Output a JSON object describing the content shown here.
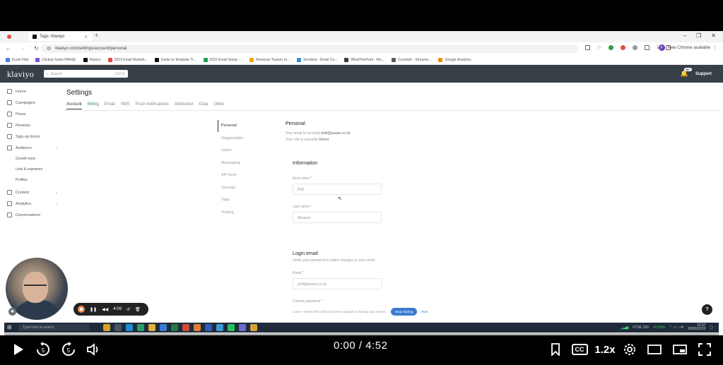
{
  "browser": {
    "tabs": [
      {
        "label": ""
      },
      {
        "label": "Tags: Klaviyo"
      }
    ],
    "url": "klaviyo.com/settings/account/personal",
    "profile_label": "New Chrome available",
    "bookmarks": [
      {
        "label": "Ecom Hub",
        "color": "#4a7de0"
      },
      {
        "label": "Clickup Tasks PAASE",
        "color": "#7b52d9"
      },
      {
        "label": "Klaviyo",
        "color": "#111111"
      },
      {
        "label": "2023 Email Marketi...",
        "color": "#e04b3a"
      },
      {
        "label": "Guide to Template Ti...",
        "color": "#111111"
      },
      {
        "label": "2022 Email Setup -...",
        "color": "#1e9e58"
      },
      {
        "label": "Revenue Tracker m...",
        "color": "#f0a400"
      },
      {
        "label": "Sendinio - Email Co...",
        "color": "#3a8be0"
      },
      {
        "label": "WhatThePoint - Mo...",
        "color": "#3a3a3a"
      },
      {
        "label": "Curentsh - Streame...",
        "color": "#5a5a5a"
      },
      {
        "label": "Google Analytics",
        "color": "#f08c00"
      }
    ]
  },
  "klaviyo": {
    "logo": "klaviyo",
    "search_placeholder": "Search",
    "search_shortcut": "Ctrl+K",
    "notifications_badge": "99+",
    "support_label": "Support",
    "sidebar": {
      "items": [
        {
          "label": "Home",
          "chevron": false
        },
        {
          "label": "Campaigns",
          "chevron": false
        },
        {
          "label": "Flows",
          "chevron": false
        },
        {
          "label": "Reviews",
          "chevron": false
        },
        {
          "label": "Sign-up forms",
          "chevron": false
        },
        {
          "label": "Audience",
          "chevron": true
        }
      ],
      "audience_sub": [
        "Growth tools",
        "Lists & segments",
        "Profiles"
      ],
      "items_bottom": [
        {
          "label": "Content",
          "chevron": true
        },
        {
          "label": "Analytics",
          "chevron": true
        },
        {
          "label": "Conversations",
          "chevron": false
        }
      ]
    },
    "settings": {
      "title": "Settings",
      "tabs": [
        "Account",
        "Billing",
        "Email",
        "SMS",
        "Push notifications",
        "Attribution",
        "Data",
        "Other"
      ],
      "subnav": [
        "Personal",
        "Organization",
        "Users",
        "Messaging",
        "API keys",
        "Security",
        "Tags",
        "Testing"
      ]
    },
    "personal": {
      "heading": "Personal",
      "email_prefix": "Your email is currently",
      "email": "phill@paase.co.uk",
      "role_prefix": "Your role is currently",
      "role": "Owner"
    },
    "information": {
      "heading": "Information",
      "first_name_label": "First name *",
      "first_name_value": "Phill",
      "last_name_label": "Last name *",
      "last_name_value": "Mansion"
    },
    "login_email": {
      "heading": "Login email",
      "hint": "Verify your password to make changes to your email",
      "email_label": "Email *",
      "email_value": "phill@paase.co.uk",
      "password_label": "Current password *"
    },
    "help": "?"
  },
  "screen_share": {
    "text": "Loom • Screen Recorder & Screen Capture is sharing your screen.",
    "stop_label": "Stop sharing",
    "hide_label": "Hide"
  },
  "recorder": {
    "timer": "4:09"
  },
  "taskbar": {
    "search_placeholder": "Type here to search",
    "ticker": "FTSE 100",
    "ticker_change": "+0.16%",
    "time": "13:57",
    "date": "29/06/2023"
  },
  "player": {
    "current_time": "0:00",
    "duration": "4:52",
    "speed": "1.2x",
    "cc": "CC"
  }
}
